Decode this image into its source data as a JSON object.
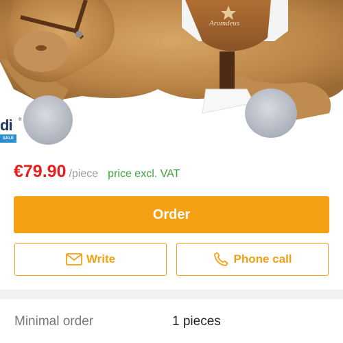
{
  "product": {
    "image_alt": "plush-camel-toy",
    "saddle_text": "Aromdeus",
    "brand": {
      "name": "di",
      "tag": "SALE"
    }
  },
  "pricing": {
    "price": "€79.90",
    "unit": "/piece",
    "vat_note": "price excl. VAT"
  },
  "actions": {
    "order_label": "Order",
    "write_label": "Write",
    "call_label": "Phone call"
  },
  "details": {
    "minimal_order_label": "Minimal order",
    "minimal_order_value": "1 pieces"
  },
  "colors": {
    "accent": "#f5a013",
    "price": "#e3201b",
    "vat": "#3ca13c"
  },
  "icons": {
    "write": "envelope-icon",
    "call": "phone-icon"
  }
}
